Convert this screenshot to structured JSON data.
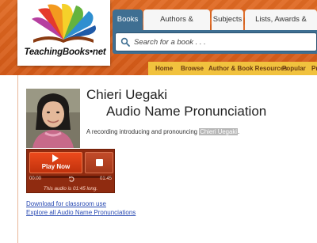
{
  "brand": {
    "logo_text": "TeachingBooks•net",
    "accent_orange": "#d45a18",
    "accent_blue": "#3f6f92",
    "nav_yellow": "#f1c23e"
  },
  "tabs": [
    {
      "label": "Books",
      "active": true
    },
    {
      "label": "Authors & Illustrators",
      "active": false
    },
    {
      "label": "Subjects",
      "active": false
    },
    {
      "label": "Lists, Awards & Series",
      "active": false
    }
  ],
  "search": {
    "placeholder": "Search for a book . . ."
  },
  "nav": [
    "Home",
    "Browse",
    "Author & Book Resources",
    "Popular",
    "Pr"
  ],
  "author": {
    "name": "Chieri Uegaki",
    "photo_icon": "author-photo"
  },
  "page": {
    "title": "Audio Name Pronunciation",
    "description_prefix": "A recording introducing and pronouncing ",
    "description_highlight": "Chieri Uegaki",
    "description_suffix": "."
  },
  "player": {
    "play_label": "Play Now",
    "time_current": "00:00",
    "time_total": "01:45",
    "length_text": "This audio is 01:45 long."
  },
  "links": {
    "download": "Download for classroom use",
    "explore": "Explore all Audio Name Pronunciations"
  }
}
